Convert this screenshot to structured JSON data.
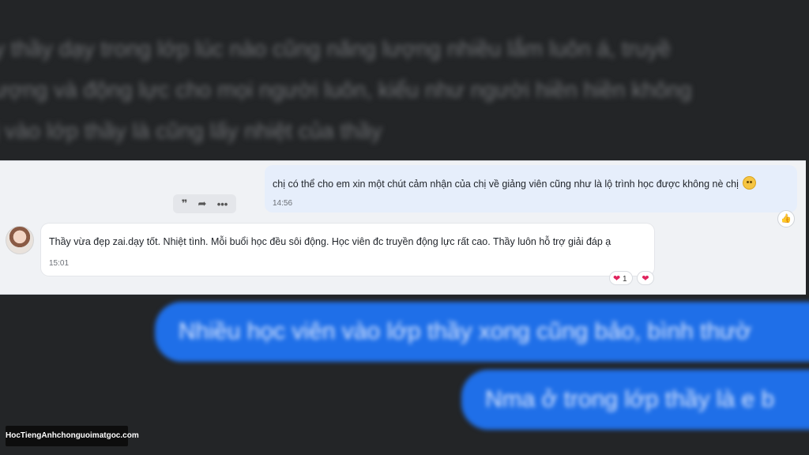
{
  "background_text": {
    "lines": [
      "y thầy dạy trong lớp lúc nào cũng năng lượng nhiều lắm luôn á, truyề",
      "ượng và động lực cho mọi người luôn, kiểu như người hiền hiền không",
      "ị vào lớp thầy là cũng lấy nhiệt của thầy"
    ]
  },
  "outgoing_message": {
    "text": "chị có thể cho em xin một chút cảm nhận của chị về giảng viên cũng như là lộ trình học được không nè chị",
    "time": "14:56",
    "emoji": "flushed-face-emoji"
  },
  "message_actions": {
    "quote_icon": "❞",
    "forward_icon": "➦",
    "more_icon": "•••"
  },
  "like_icon": "👍",
  "incoming_message": {
    "text": "Thầy vừa đẹp zai.dạy tốt. Nhiệt tình. Mỗi buổi học đều sôi động. Học viên đc truyền động lực rất cao. Thầy luôn hỗ trợ giải đáp ạ",
    "time": "15:01",
    "reactions": [
      {
        "icon": "heart-icon",
        "glyph": "❤",
        "count": "1"
      },
      {
        "icon": "heart-icon",
        "glyph": "❤",
        "count": ""
      }
    ]
  },
  "blue_bubbles": [
    "Nhiều học viên vào lớp thầy xong cũng bảo, bình thườ",
    "Nma ở trong lớp thầy là e b"
  ],
  "watermark": "HocTiengAnhchonguoimatgoc.com",
  "colors": {
    "background": "#232527",
    "blue_bubble": "#1f6fe8",
    "outgoing_bubble": "#e6eefb",
    "heart": "#e0245e"
  }
}
